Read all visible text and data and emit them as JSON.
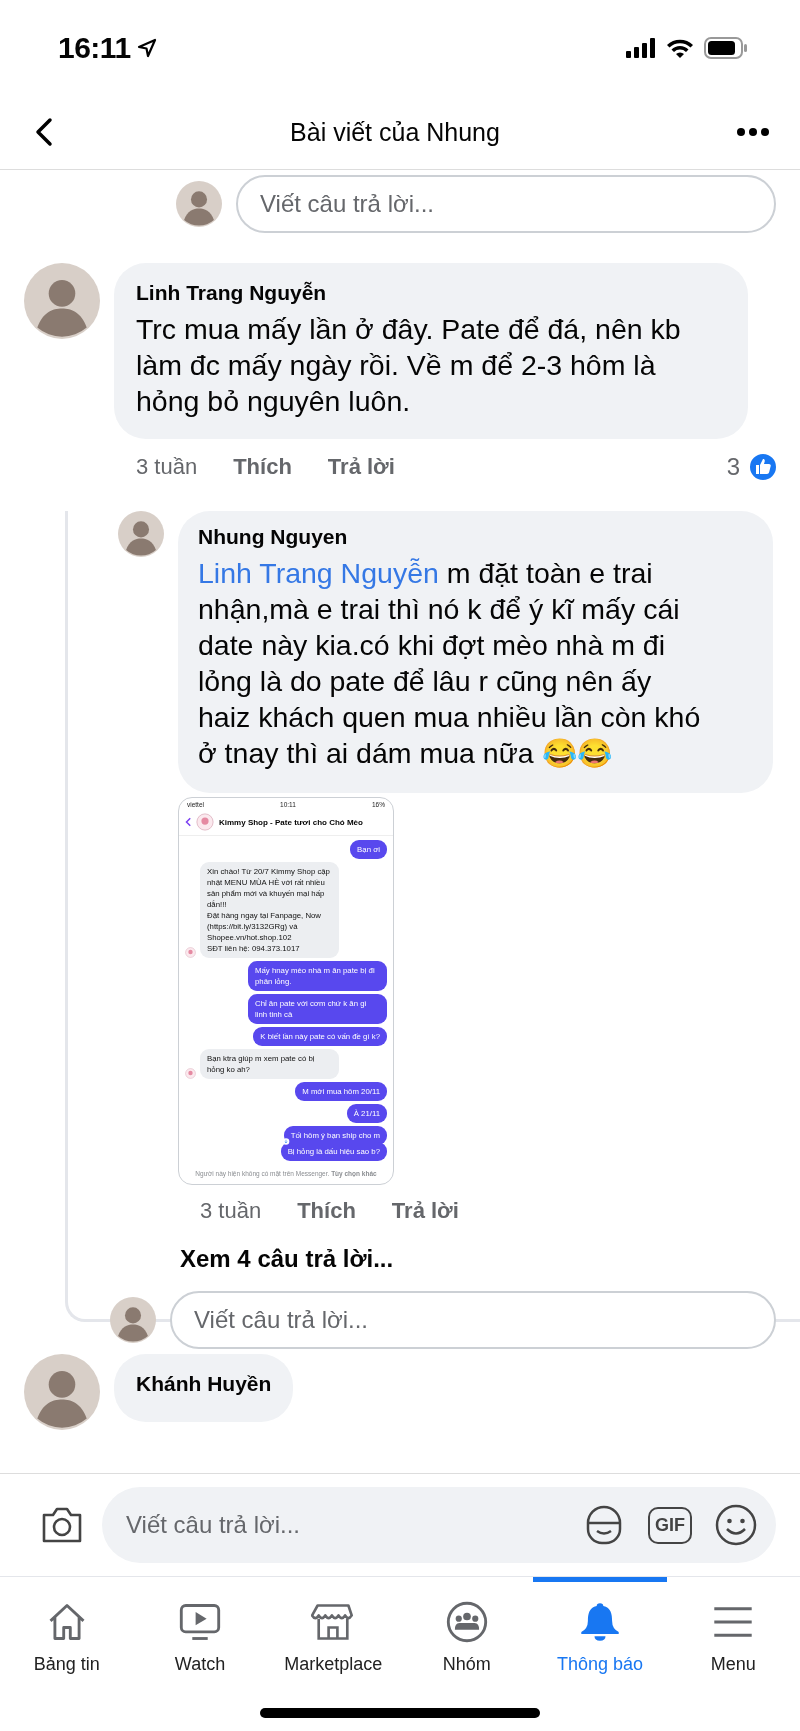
{
  "status_bar": {
    "time": "16:11"
  },
  "header": {
    "title": "Bài viết của Nhung"
  },
  "reply_box_top": {
    "placeholder": "Viết câu trả lời..."
  },
  "comments": [
    {
      "author": "Linh Trang Nguyễn",
      "text": "Trc mua mấy lần ở đây. Pate để đá, nên kb làm đc mấy ngày rồi. Về m để 2-3 hôm là hỏng bỏ nguyên luôn.",
      "time": "3 tuần",
      "like": "Thích",
      "reply": "Trả lời",
      "reaction_count": "3",
      "replies": [
        {
          "author": "Nhung Nguyen",
          "mention": "Linh Trang Nguyễn",
          "text": " m đặt toàn e trai nhận,mà e trai thì nó k để ý kĩ mấy cái date này kia.có khi đợt mèo nhà m đi lỏng là do pate để lâu r cũng nên ấy haiz khách quen mua nhiều lần còn khó ở tnay thì ai dám mua nữa 😂😂",
          "attachment": {
            "carrier": "viettel",
            "status_time": "10:11",
            "battery": "16%",
            "chat_title": "Kimmy Shop - Pate tươi cho Chó Mèo",
            "messages": [
              {
                "kind": "sent",
                "text": "Bạn ơi"
              },
              {
                "kind": "received",
                "text": "Xin chào! Từ 20/7 Kimmy Shop cập nhật MENU MÙA HÈ với rất nhiều sản phẩm mới và khuyến mại hấp dẫn!!!\nĐặt hàng ngay tại Fanpage, Now (https://bit.ly/3132GRg) và Shopee.vn/hot.shop.102\nSĐT liên hệ: 094.373.1017"
              },
              {
                "kind": "sent",
                "text": "Mấy hnay mèo nhà m ăn pate bị đi phân lỏng."
              },
              {
                "kind": "sent",
                "text": "Chỉ ăn pate với cơm chứ k ăn gì linh tinh cả"
              },
              {
                "kind": "sent",
                "text": "K biết lần này pate có vấn đề gì k?"
              },
              {
                "kind": "received",
                "text": "Bạn ktra giúp m xem pate có bị hỏng ko ah?"
              },
              {
                "kind": "sent",
                "text": "M mới mua hôm 20/11"
              },
              {
                "kind": "sent",
                "text": "À 21/11"
              },
              {
                "kind": "sent",
                "text": "Tối hôm ý bạn ship cho m"
              },
              {
                "kind": "sent",
                "text": "Bị hỏng là dấu hiệu sao b?"
              }
            ],
            "footer": "Người này hiện không có mặt trên Messenger. **Tùy chọn khác**"
          },
          "time": "3 tuần",
          "like": "Thích",
          "reply": "Trả lời"
        }
      ],
      "more_replies": "Xem 4 câu trả lời...",
      "reply_box": {
        "placeholder": "Viết câu trả lời..."
      }
    },
    {
      "author": "Khánh Huyền"
    }
  ],
  "composer": {
    "placeholder": "Viết câu trả lời...",
    "gif": "GIF"
  },
  "tabs": [
    {
      "kind": "home",
      "label": "Bảng tin",
      "selected": false
    },
    {
      "kind": "watch",
      "label": "Watch",
      "selected": false
    },
    {
      "kind": "store",
      "label": "Marketplace",
      "selected": false
    },
    {
      "kind": "groups",
      "label": "Nhóm",
      "selected": false
    },
    {
      "kind": "bell",
      "label": "Thông báo",
      "selected": true
    },
    {
      "kind": "menu",
      "label": "Menu",
      "selected": false
    }
  ]
}
